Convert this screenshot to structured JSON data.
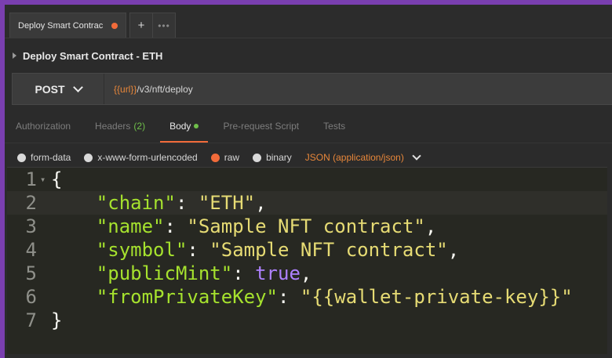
{
  "tab": {
    "title": "Deploy Smart Contrac",
    "add_label": "+",
    "more_label": "•••"
  },
  "request": {
    "name": "Deploy Smart Contract - ETH"
  },
  "urlbar": {
    "method": "POST",
    "url_var": "{{url}}",
    "url_path": "/v3/nft/deploy"
  },
  "subtabs": {
    "authorization": "Authorization",
    "headers": "Headers",
    "headers_count": "(2)",
    "body": "Body",
    "prerequest": "Pre-request Script",
    "tests": "Tests"
  },
  "bodytype": {
    "formdata": "form-data",
    "urlencoded": "x-www-form-urlencoded",
    "raw": "raw",
    "binary": "binary",
    "content_type": "JSON (application/json)"
  },
  "editor": {
    "line_numbers": [
      "1",
      "2",
      "3",
      "4",
      "5",
      "6",
      "7"
    ],
    "open_brace": "{",
    "close_brace": "}",
    "lines": [
      {
        "key": "\"chain\"",
        "value": "\"ETH\""
      },
      {
        "key": "\"name\"",
        "value": "\"Sample NFT contract\""
      },
      {
        "key": "\"symbol\"",
        "value": "\"Sample NFT contract\""
      },
      {
        "key": "\"publicMint\"",
        "value": "true"
      },
      {
        "key": "\"fromPrivateKey\"",
        "value": "\"{{wallet-private-key}}\""
      }
    ]
  }
}
